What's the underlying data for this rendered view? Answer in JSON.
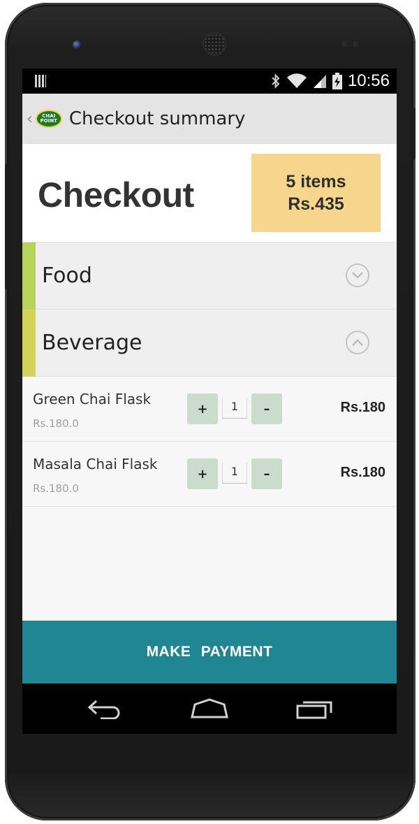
{
  "status_bar": {
    "time": "10:56"
  },
  "app_bar": {
    "logo_text": "CHAI POINT",
    "title": "Checkout summary"
  },
  "checkout": {
    "title": "Checkout",
    "item_count": "5 items",
    "total": "Rs.435"
  },
  "categories": [
    {
      "label": "Food",
      "color": "#b7d35a",
      "expanded": false
    },
    {
      "label": "Beverage",
      "color": "#d3d35a",
      "expanded": true
    }
  ],
  "items": [
    {
      "name": "Green Chai Flask",
      "unit_price": "Rs.180.0",
      "plus": "+",
      "qty": "1",
      "minus": "–",
      "total": "Rs.180"
    },
    {
      "name": "Masala Chai Flask",
      "unit_price": "Rs.180.0",
      "plus": "+",
      "qty": "1",
      "minus": "–",
      "total": "Rs.180"
    }
  ],
  "payment_button": {
    "label": "MAKE PAYMENT",
    "color": "#218693"
  },
  "colors": {
    "summary_box": "#f6d68c",
    "qty_button": "#cbdccd"
  },
  "nav": {
    "back": "back-icon",
    "home": "home-icon",
    "recents": "recents-icon"
  }
}
